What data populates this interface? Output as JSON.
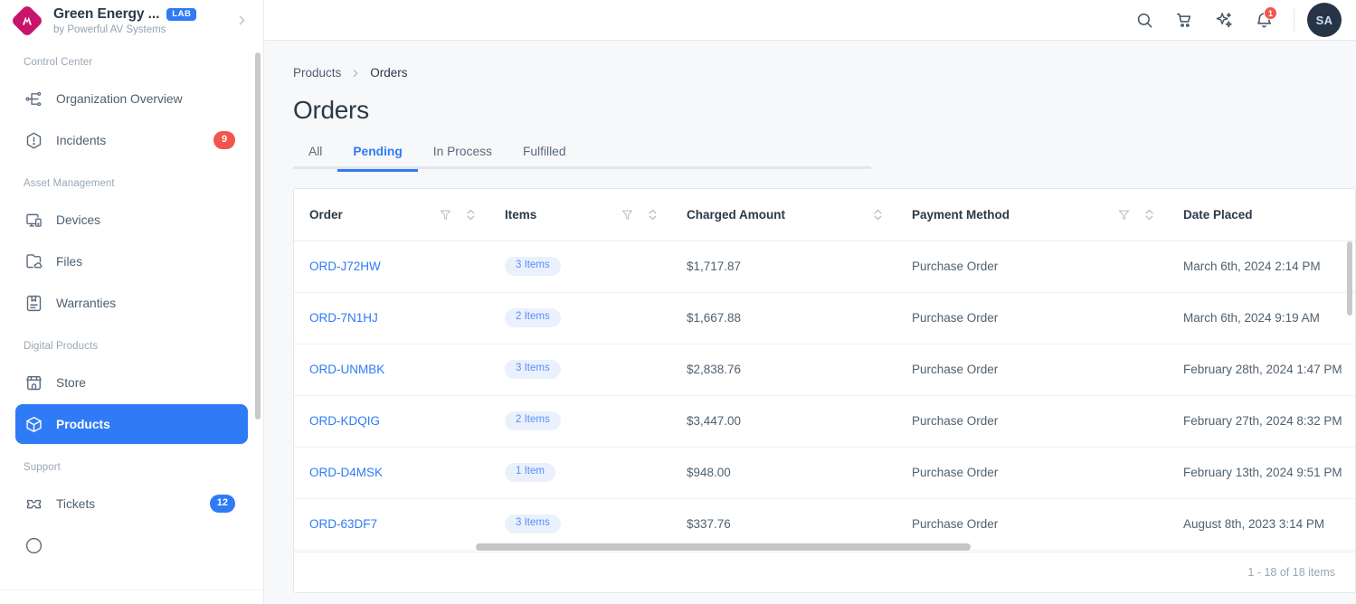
{
  "sidebar": {
    "brand": {
      "title": "Green Energy ...",
      "badge": "LAB",
      "subtitle": "by Powerful AV Systems"
    },
    "groups": [
      {
        "label": "Control Center",
        "items": [
          {
            "label": "Organization Overview",
            "icon": "org-chart-icon",
            "badge": null,
            "active": false
          },
          {
            "label": "Incidents",
            "icon": "alert-hexagon-icon",
            "badge": "9",
            "badge_color": "#f0564c",
            "active": false
          }
        ]
      },
      {
        "label": "Asset Management",
        "items": [
          {
            "label": "Devices",
            "icon": "devices-icon",
            "badge": null,
            "active": false
          },
          {
            "label": "Files",
            "icon": "folder-cloud-icon",
            "badge": null,
            "active": false
          },
          {
            "label": "Warranties",
            "icon": "warranty-bookmark-icon",
            "badge": null,
            "active": false
          }
        ]
      },
      {
        "label": "Digital Products",
        "items": [
          {
            "label": "Store",
            "icon": "store-icon",
            "badge": null,
            "active": false
          },
          {
            "label": "Products",
            "icon": "box-icon",
            "badge": null,
            "active": true
          }
        ]
      },
      {
        "label": "Support",
        "items": [
          {
            "label": "Tickets",
            "icon": "ticket-icon",
            "badge": "12",
            "badge_color": "#2f7bf6",
            "active": false
          }
        ]
      }
    ]
  },
  "topbar": {
    "icons": [
      "search-icon",
      "shopping-cart-icon",
      "sparkles-icon",
      "bell-icon"
    ],
    "notification_count": "1",
    "avatar_initials": "SA"
  },
  "breadcrumb": {
    "parent": "Products",
    "current": "Orders"
  },
  "page": {
    "title": "Orders"
  },
  "tabs": [
    {
      "label": "All",
      "active": false
    },
    {
      "label": "Pending",
      "active": true
    },
    {
      "label": "In Process",
      "active": false
    },
    {
      "label": "Fulfilled",
      "active": false
    }
  ],
  "table": {
    "columns": [
      {
        "label": "Order",
        "filter": true,
        "sort": true
      },
      {
        "label": "Items",
        "filter": true,
        "sort": true
      },
      {
        "label": "Charged Amount",
        "filter": false,
        "sort": true
      },
      {
        "label": "Payment Method",
        "filter": true,
        "sort": true
      },
      {
        "label": "Date Placed",
        "filter": true,
        "sort": false
      }
    ],
    "rows": [
      {
        "order": "ORD-J72HW",
        "items": "3 Items",
        "amount": "$1,717.87",
        "payment": "Purchase Order",
        "date": "March 6th, 2024 2:14 PM"
      },
      {
        "order": "ORD-7N1HJ",
        "items": "2 Items",
        "amount": "$1,667.88",
        "payment": "Purchase Order",
        "date": "March 6th, 2024 9:19 AM"
      },
      {
        "order": "ORD-UNMBK",
        "items": "3 Items",
        "amount": "$2,838.76",
        "payment": "Purchase Order",
        "date": "February 28th, 2024 1:47 PM"
      },
      {
        "order": "ORD-KDQIG",
        "items": "2 Items",
        "amount": "$3,447.00",
        "payment": "Purchase Order",
        "date": "February 27th, 2024 8:32 PM"
      },
      {
        "order": "ORD-D4MSK",
        "items": "1 Item",
        "amount": "$948.00",
        "payment": "Purchase Order",
        "date": "February 13th, 2024 9:51 PM"
      },
      {
        "order": "ORD-63DF7",
        "items": "3 Items",
        "amount": "$337.76",
        "payment": "Purchase Order",
        "date": "August 8th, 2023 3:14 PM"
      }
    ],
    "footer_count": "1 - 18 of 18 items"
  },
  "colors": {
    "accent": "#2f7bf6",
    "danger": "#f0564c",
    "logo": "#c8146a",
    "text": "#2b3a4a"
  }
}
